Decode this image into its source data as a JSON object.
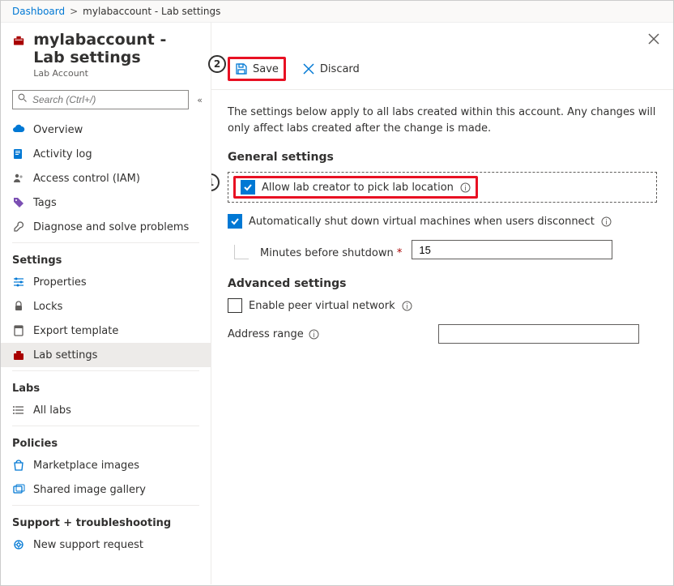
{
  "breadcrumb": {
    "root": "Dashboard",
    "current": "mylabaccount - Lab settings"
  },
  "header": {
    "title": "mylabaccount - Lab settings",
    "subtitle": "Lab Account"
  },
  "search": {
    "placeholder": "Search (Ctrl+/)"
  },
  "nav": {
    "overview": "Overview",
    "activity_log": "Activity log",
    "access_control": "Access control (IAM)",
    "tags": "Tags",
    "diagnose": "Diagnose and solve problems",
    "group_settings": "Settings",
    "properties": "Properties",
    "locks": "Locks",
    "export_template": "Export template",
    "lab_settings": "Lab settings",
    "group_labs": "Labs",
    "all_labs": "All labs",
    "group_policies": "Policies",
    "marketplace_images": "Marketplace images",
    "shared_gallery": "Shared image gallery",
    "group_support": "Support + troubleshooting",
    "new_support": "New support request"
  },
  "toolbar": {
    "save": "Save",
    "discard": "Discard"
  },
  "content": {
    "intro": "The settings below apply to all labs created within this account. Any changes will only affect labs created after the change is made.",
    "general_title": "General settings",
    "cb_allow_location": "Allow lab creator to pick lab location",
    "cb_auto_shutdown": "Automatically shut down virtual machines when users disconnect",
    "minutes_label": "Minutes before shutdown",
    "minutes_value": "15",
    "advanced_title": "Advanced settings",
    "cb_peer_vnet": "Enable peer virtual network",
    "address_range": "Address range",
    "address_range_value": ""
  },
  "annotations": {
    "one": "1",
    "two": "2"
  }
}
